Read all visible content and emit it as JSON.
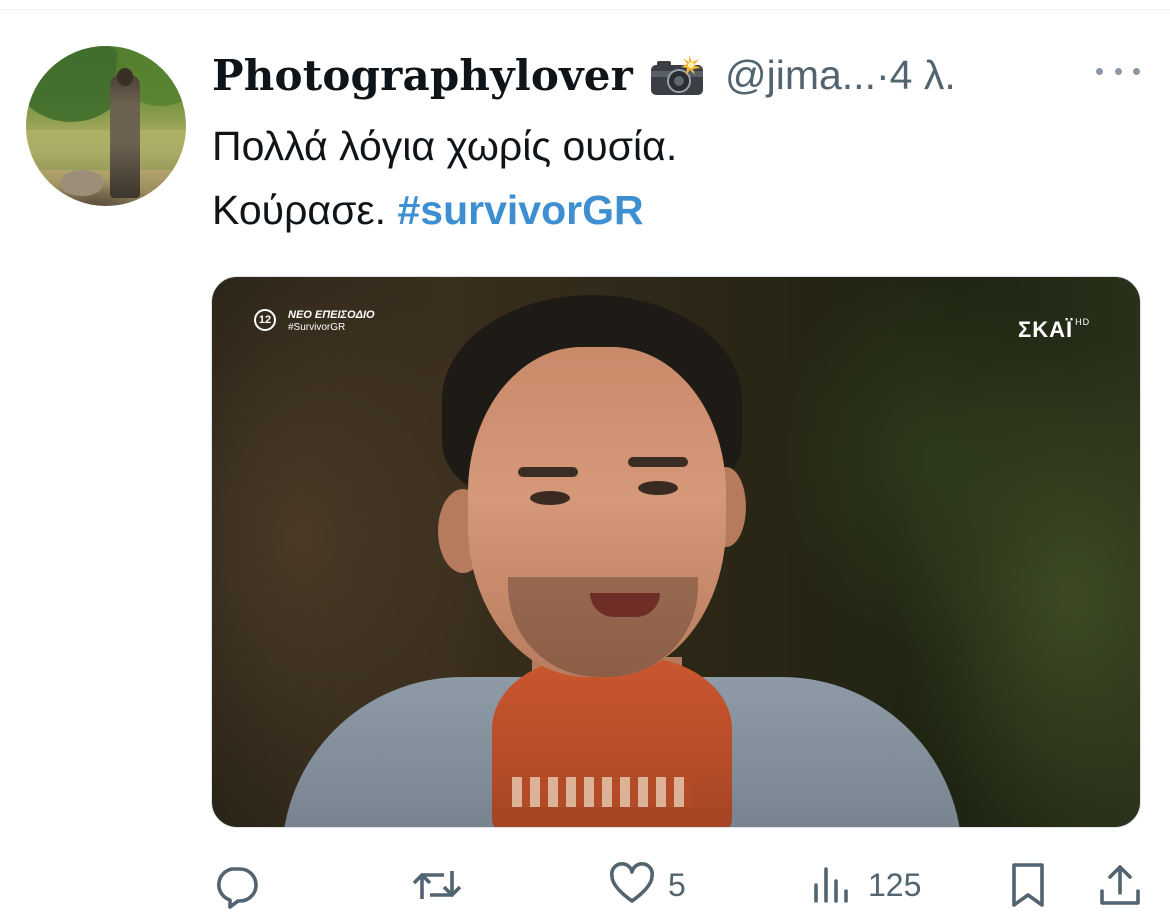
{
  "tweet": {
    "display_name": "Photographylover",
    "name_emoji": "camera-with-flash",
    "handle": "@jima...",
    "time": "·4 λ.",
    "text_line1": "Πολλά λόγια χωρίς ουσία.",
    "text_line2_prefix": "Κούρασε. ",
    "hashtag": "#survivorGR"
  },
  "media": {
    "channel_number": "12",
    "overlay_line1": "ΝΕΟ ΕΠΕΙΣΟΔΙΟ",
    "overlay_line2": "#SurvivorGR",
    "broadcaster_logo": "ΣΚΑΪ",
    "broadcaster_hd": "HD"
  },
  "actions": {
    "reply_icon": "reply-icon",
    "retweet_icon": "retweet-icon",
    "like_icon": "heart-icon",
    "likes": "5",
    "views_icon": "views-icon",
    "views": "125",
    "bookmark_icon": "bookmark-icon",
    "share_icon": "share-icon"
  },
  "colors": {
    "text": "#0f1419",
    "secondary": "#536471",
    "hashtag": "#3d8fd1"
  }
}
